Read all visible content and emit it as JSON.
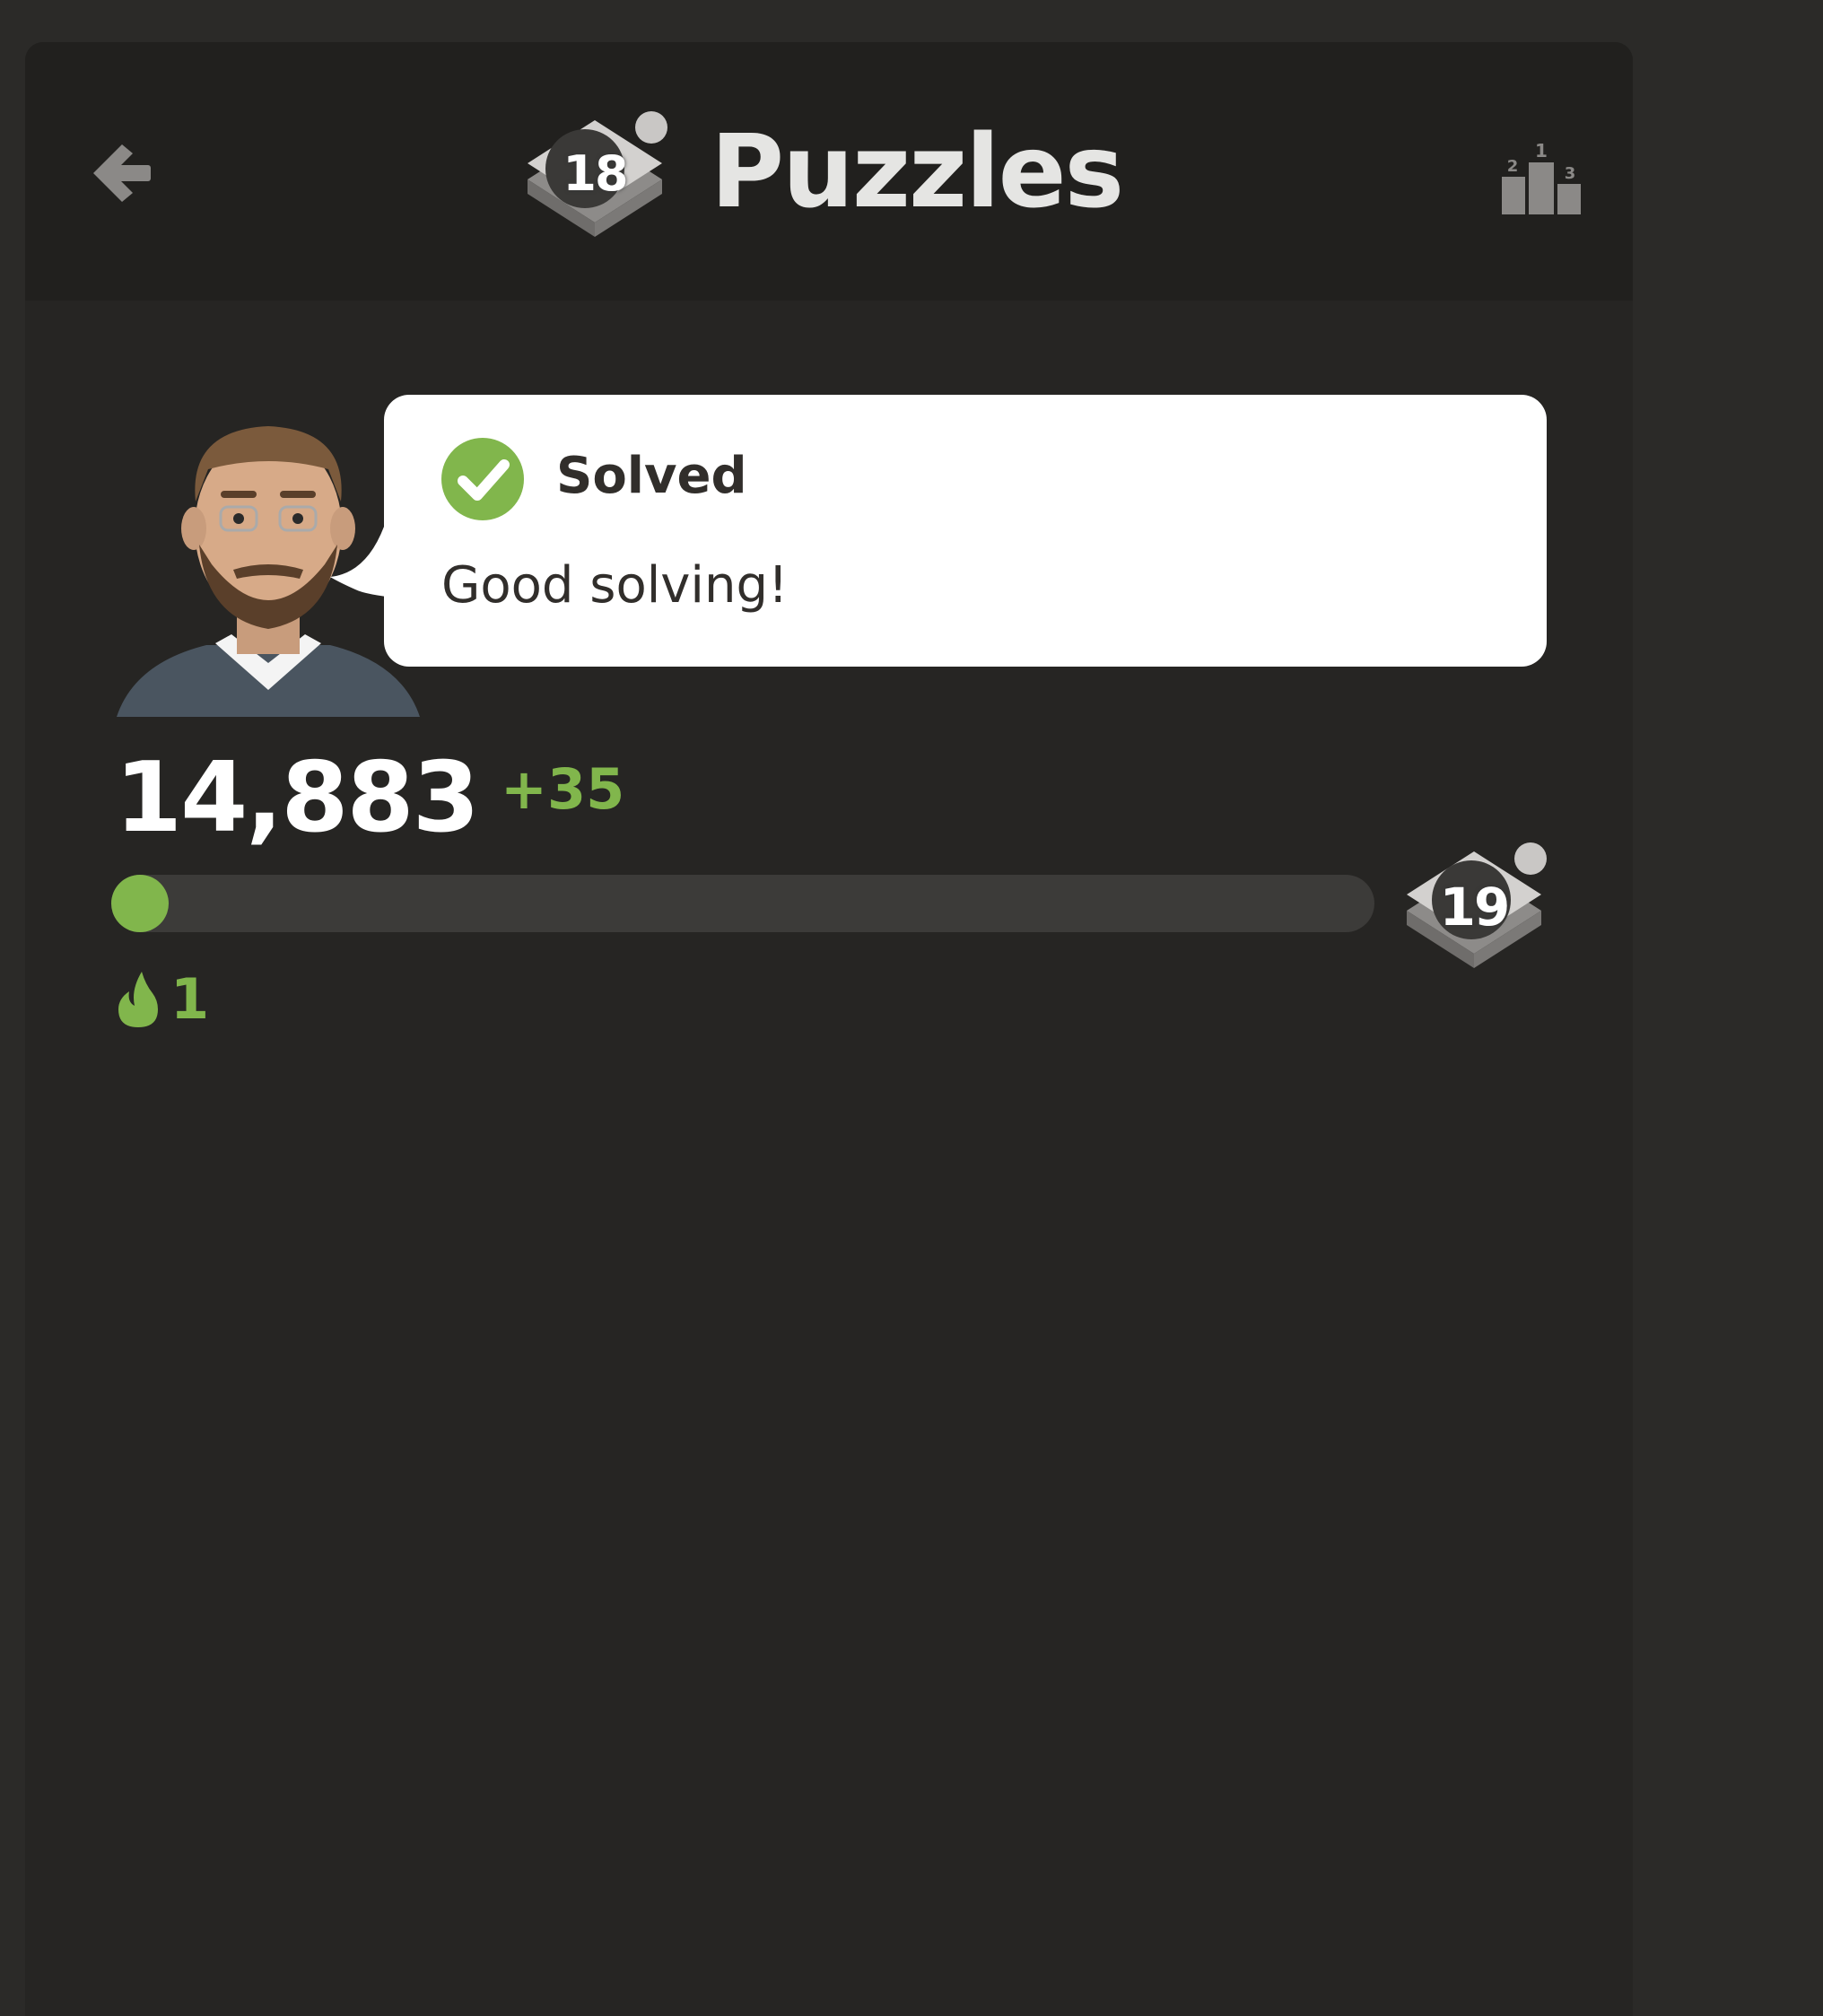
{
  "header": {
    "title": "Puzzles",
    "level": "18",
    "back_icon": "arrow-left-icon",
    "leaderboard_icon": "podium-icon"
  },
  "feedback": {
    "status": "Solved",
    "message": "Good solving!",
    "status_icon": "check-circle-icon",
    "avatar": "coach-avatar"
  },
  "rating": {
    "value": "14,883",
    "delta": "+35"
  },
  "progress": {
    "fraction": 0.0,
    "next_level": "19"
  },
  "streak": {
    "icon": "flame-icon",
    "count": "1"
  },
  "colors": {
    "accent": "#81b64c",
    "background": "#262523",
    "header": "#21201e"
  }
}
